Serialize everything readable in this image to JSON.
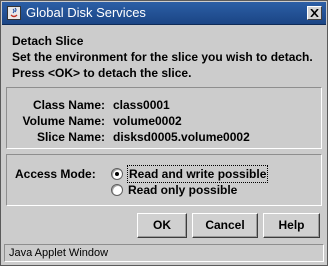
{
  "window": {
    "title": "Global Disk Services",
    "icons": {
      "app": "java-app-icon",
      "close": "close-icon"
    }
  },
  "header": {
    "heading": "Detach Slice",
    "line1": "Set the environment for the slice you wish to detach.",
    "line2": "Press <OK> to detach the slice."
  },
  "info": {
    "rows": [
      {
        "label": "Class Name:",
        "value": "class0001"
      },
      {
        "label": "Volume Name:",
        "value": "volume0002"
      },
      {
        "label": "Slice Name:",
        "value": "disksd0005.volume0002"
      }
    ]
  },
  "access": {
    "label": "Access Mode:",
    "options": [
      {
        "label": "Read and write possible",
        "selected": true
      },
      {
        "label": "Read only possible",
        "selected": false
      }
    ]
  },
  "buttons": {
    "ok": "OK",
    "cancel": "Cancel",
    "help": "Help"
  },
  "status": {
    "text": "Java Applet Window"
  }
}
